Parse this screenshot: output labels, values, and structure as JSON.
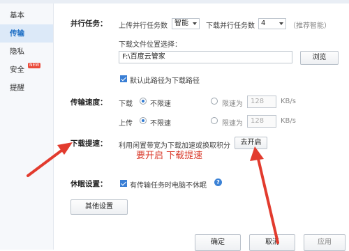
{
  "sidebar": {
    "items": [
      {
        "label": "基本"
      },
      {
        "label": "传输"
      },
      {
        "label": "隐私"
      },
      {
        "label": "安全"
      },
      {
        "label": "提醒"
      }
    ],
    "new_badge": "NEW",
    "active_index": 1
  },
  "parallel": {
    "label": "并行任务：",
    "upload_label": "上传并行任务数",
    "upload_value": "智能",
    "download_label": "下载并行任务数",
    "download_value": "4",
    "recommend": "（推荐智能）"
  },
  "location": {
    "label": "下载文件位置选择：",
    "path": "F:\\百度云管家",
    "browse_label": "浏览",
    "default_checkbox_label": "默认此路径为下载路径",
    "default_checked": true
  },
  "speed": {
    "label": "传输速度：",
    "download_label": "下载",
    "upload_label": "上传",
    "unlimited_label": "不限速",
    "limit_label": "限速为",
    "download_limit_value": "128",
    "upload_limit_value": "128",
    "unit": "KB/s",
    "download_mode": "unlimited",
    "upload_mode": "unlimited"
  },
  "boost": {
    "label": "下载提速：",
    "description": "利用闲置带宽为下载加速或换取积分",
    "button_label": "去开启",
    "annotation": "要开启  下载提速"
  },
  "sleep": {
    "label": "休眠设置：",
    "checkbox_label": "有传输任务时电脑不休眠",
    "checked": true,
    "help_icon": "question-icon"
  },
  "other_settings_label": "其他设置",
  "footer": {
    "ok_label": "确定",
    "cancel_label": "取消",
    "apply_label": "应用"
  },
  "colors": {
    "accent": "#2f7ad3",
    "annotation": "#d93a2b"
  }
}
